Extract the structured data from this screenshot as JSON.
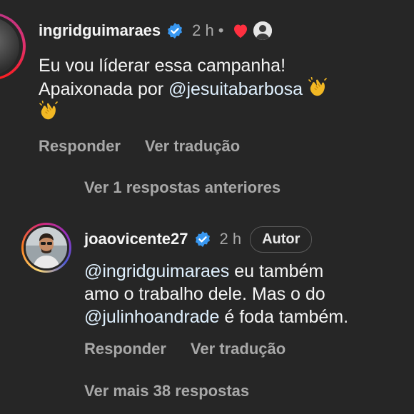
{
  "comment1": {
    "username": "ingridguimaraes",
    "time": "2 h",
    "separator": "•",
    "text_line1": "Eu vou líderar essa campanha!",
    "text_line2_prefix": "Apaixonada por ",
    "mention": "@jesuitabarbosa",
    "reply_label": "Responder",
    "translate_label": "Ver tradução"
  },
  "previous_replies": "Ver 1 respostas anteriores",
  "comment2": {
    "username": "joaovicente27",
    "time": "2 h",
    "author_badge": "Autor",
    "mention1": "@ingridguimaraes",
    "text_part1": " eu também",
    "text_line2": "amo o trabalho dele. Mas o do",
    "mention2": "@julinhoandrade",
    "text_part3": " é foda também.",
    "reply_label": "Responder",
    "translate_label": "Ver tradução"
  },
  "more_replies": "Ver mais 38 respostas",
  "colors": {
    "background": "#262626",
    "verified": "#3897f0",
    "heart": "#ff3040",
    "secondary_text": "#a8a8a8"
  },
  "icons": [
    "verified-badge-icon",
    "heart-icon",
    "clapping-hands-icon"
  ]
}
